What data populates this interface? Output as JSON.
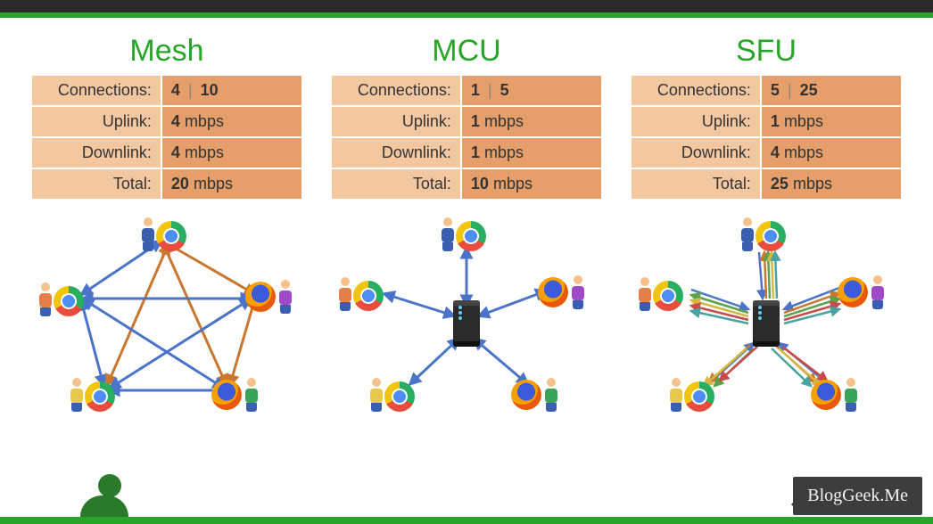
{
  "columns": [
    {
      "title": "Mesh",
      "rows": {
        "connections_label": "Connections:",
        "connections_a": "4",
        "connections_b": "10",
        "uplink_label": "Uplink:",
        "uplink_val": "4",
        "uplink_unit": "mbps",
        "downlink_label": "Downlink:",
        "downlink_val": "4",
        "downlink_unit": "mbps",
        "total_label": "Total:",
        "total_val": "20",
        "total_unit": "mbps"
      }
    },
    {
      "title": "MCU",
      "rows": {
        "connections_label": "Connections:",
        "connections_a": "1",
        "connections_b": "5",
        "uplink_label": "Uplink:",
        "uplink_val": "1",
        "uplink_unit": "mbps",
        "downlink_label": "Downlink:",
        "downlink_val": "1",
        "downlink_unit": "mbps",
        "total_label": "Total:",
        "total_val": "10",
        "total_unit": "mbps"
      }
    },
    {
      "title": "SFU",
      "rows": {
        "connections_label": "Connections:",
        "connections_a": "5",
        "connections_b": "25",
        "uplink_label": "Uplink:",
        "uplink_val": "1",
        "uplink_unit": "mbps",
        "downlink_label": "Downlink:",
        "downlink_val": "4",
        "downlink_unit": "mbps",
        "total_label": "Total:",
        "total_val": "25",
        "total_unit": "mbps"
      }
    }
  ],
  "brand": "BlogGeek.Me",
  "colors": {
    "green": "#28a428",
    "arrow_blue": "#4a74c9",
    "arrow_orange": "#c9762f",
    "arrow_green": "#5aa34a",
    "arrow_yellow": "#d4b843",
    "arrow_red": "#c94a4a",
    "arrow_teal": "#4aa3a3"
  }
}
